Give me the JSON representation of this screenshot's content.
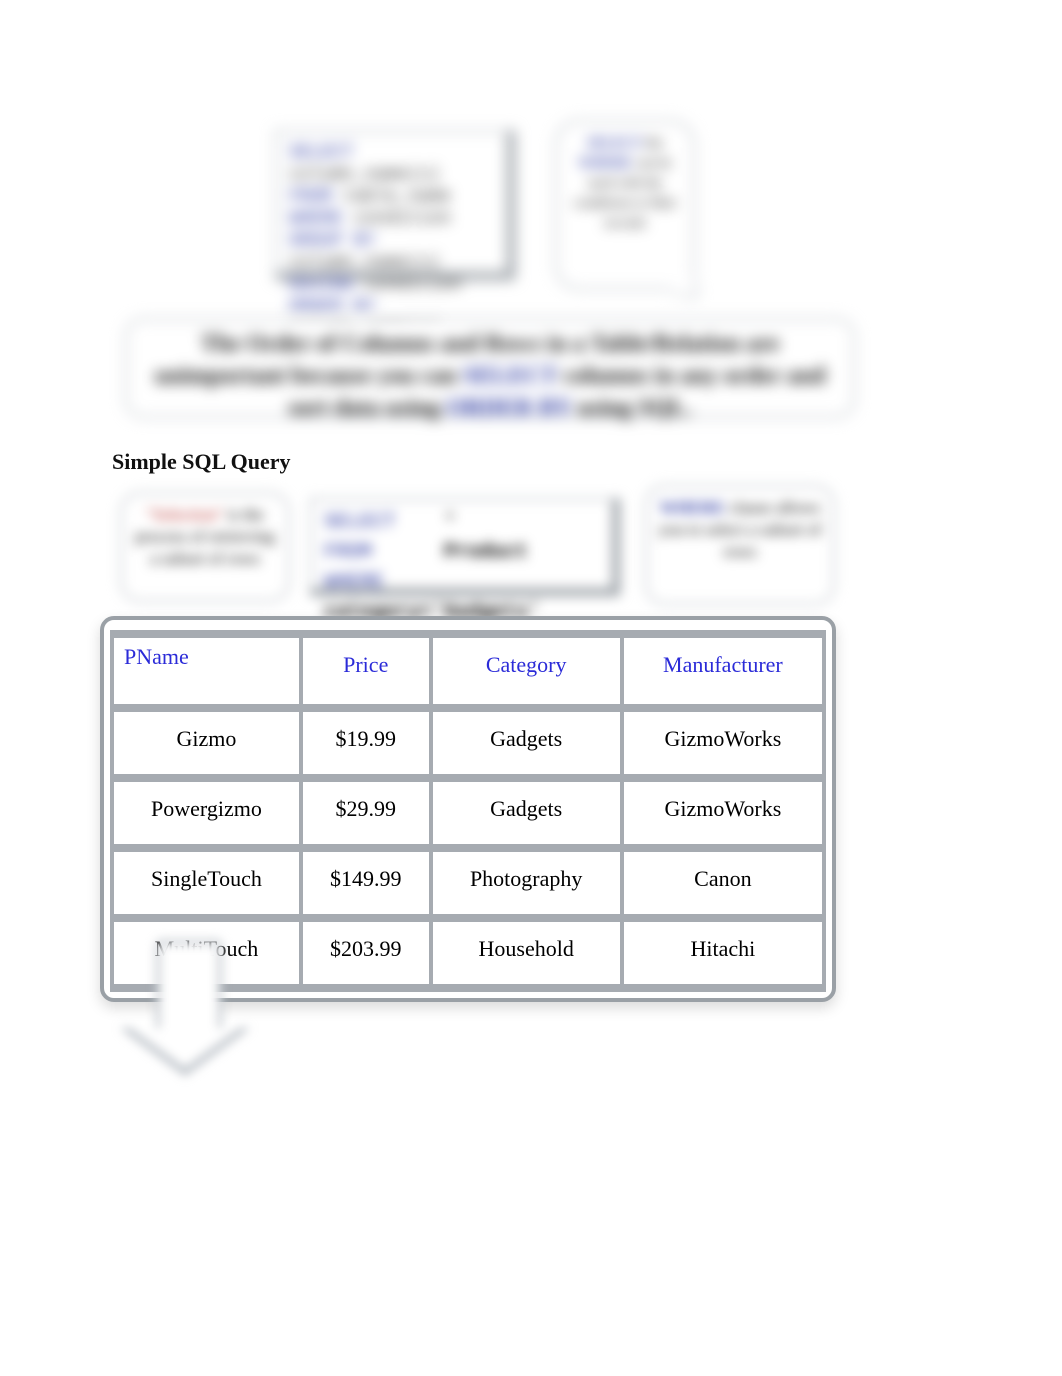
{
  "syntax_card": {
    "l1_kw": "SELECT",
    "l1_val": "column_name(s)",
    "l2_kw": "FROM",
    "l2_val": "table_name",
    "l3_kw": "WHERE",
    "l3_val": "condition",
    "l4_kw": "GROUP BY",
    "l4_val": "column_name(s)",
    "l5_kw": "HAVING",
    "l5_val": "condition",
    "l6_kw": "ORDER BY",
    "l6_val": "column_name(s)"
  },
  "bubble1": {
    "kw1": "SELECT",
    "t1": "the",
    "kw2": "WHERE",
    "t2": "can be used with the",
    "t3": "conditions to filter records"
  },
  "banner": {
    "pre": "The Order of Columns and Rows in a Table/Relation are unimportant because you can ",
    "kw1": "SELECT",
    "mid1": " columns in any order and sort data using ",
    "kw2": "ORDER BY",
    "mid2": " using SQL."
  },
  "section_heading": "Simple SQL Query",
  "card_left": {
    "red": "\"Selection\"",
    "body": " is the process of retrieving a subset of rows"
  },
  "card_mid": {
    "select_kw": "SELECT",
    "select_val": "*",
    "from_kw": "FROM",
    "from_val": "Product",
    "where_kw": "WHERE",
    "where_val": "category='Gadgets'"
  },
  "card_right": {
    "kw": "WHERE",
    "body": " clause allows you to select a subset of rows"
  },
  "table": {
    "headers": [
      "PName",
      "Price",
      "Category",
      "Manufacturer"
    ],
    "rows": [
      {
        "pname": "Gizmo",
        "price": "$19.99",
        "category": "Gadgets",
        "manufacturer": "GizmoWorks"
      },
      {
        "pname": "Powergizmo",
        "price": "$29.99",
        "category": "Gadgets",
        "manufacturer": "GizmoWorks"
      },
      {
        "pname": "SingleTouch",
        "price": "$149.99",
        "category": "Photography",
        "manufacturer": "Canon"
      },
      {
        "pname": "MultiTouch",
        "price": "$203.99",
        "category": "Household",
        "manufacturer": "Hitachi"
      }
    ]
  }
}
